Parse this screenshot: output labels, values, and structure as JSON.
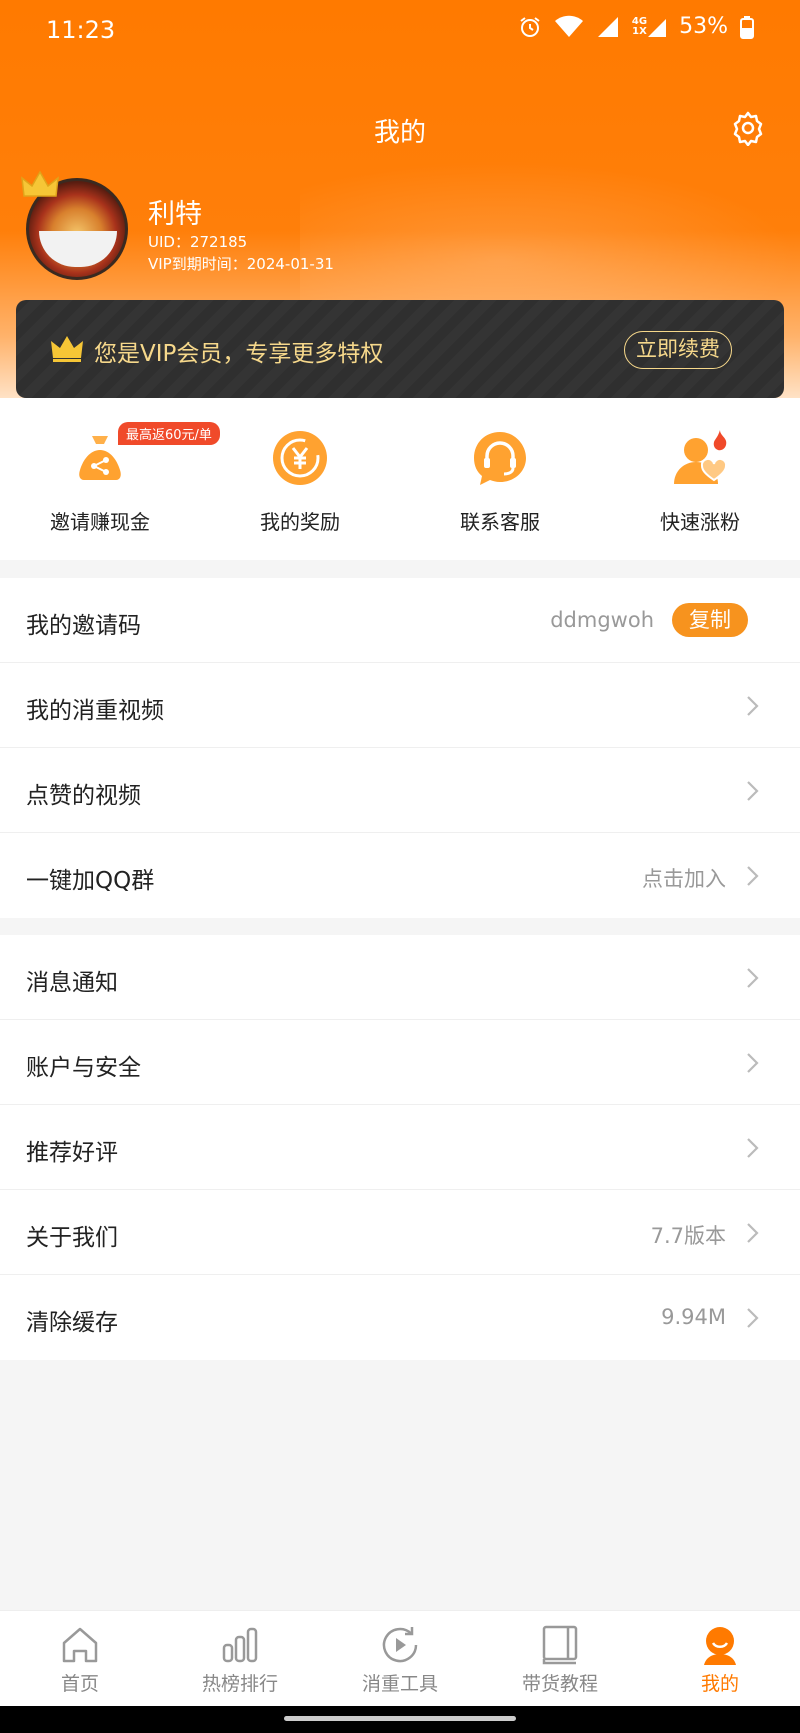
{
  "status_bar": {
    "time": "11:23",
    "net_top": "4G",
    "net_bottom": "1X",
    "battery": "53%"
  },
  "header": {
    "title": "我的"
  },
  "user": {
    "name": "利特",
    "uid": "UID：272185",
    "vip_expire": "VIP到期时间：2024-01-31"
  },
  "vip_banner": {
    "text": "您是VIP会员，专享更多特权",
    "renew_label": "立即续费",
    "text_color": "#f6d88b"
  },
  "quick_actions": {
    "badge": "最高返60元/单",
    "items": [
      {
        "label": "邀请赚现金",
        "icon": "money-bag-share-icon"
      },
      {
        "label": "我的奖励",
        "icon": "yuan-coin-icon"
      },
      {
        "label": "联系客服",
        "icon": "headset-icon"
      },
      {
        "label": "快速涨粉",
        "icon": "user-heart-fire-icon"
      }
    ]
  },
  "list_group_1": [
    {
      "label": "我的邀请码",
      "value": "ddmgwoh",
      "button": "复制"
    },
    {
      "label": "我的消重视频",
      "value": ""
    },
    {
      "label": "点赞的视频",
      "value": ""
    },
    {
      "label": "一键加QQ群",
      "value": "点击加入"
    }
  ],
  "list_group_2": [
    {
      "label": "消息通知",
      "value": ""
    },
    {
      "label": "账户与安全",
      "value": ""
    },
    {
      "label": "推荐好评",
      "value": ""
    },
    {
      "label": "关于我们",
      "value": "7.7版本"
    },
    {
      "label": "清除缓存",
      "value": "9.94M"
    }
  ],
  "tab_bar": {
    "items": [
      {
        "label": "首页",
        "icon": "home-icon"
      },
      {
        "label": "热榜排行",
        "icon": "bar-chart-icon"
      },
      {
        "label": "消重工具",
        "icon": "play-refresh-icon"
      },
      {
        "label": "带货教程",
        "icon": "book-icon"
      },
      {
        "label": "我的",
        "icon": "smile-user-icon"
      }
    ],
    "active_color": "#ff7a00"
  },
  "colors": {
    "brand_orange": "#ff7a00",
    "copy_button": "#f7931e"
  }
}
